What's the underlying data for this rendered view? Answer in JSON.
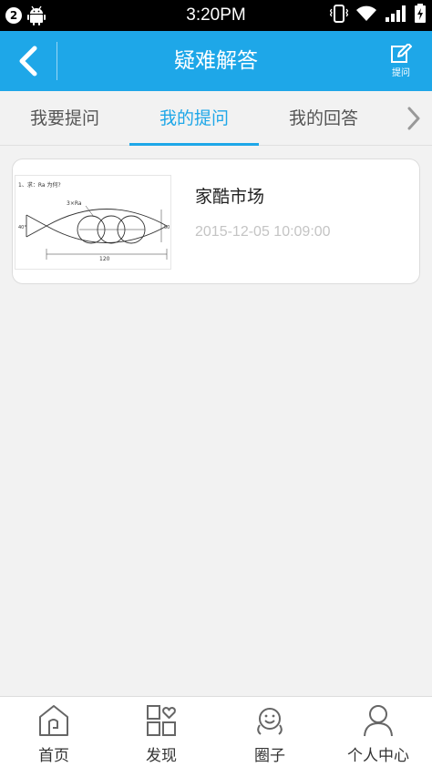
{
  "status_bar": {
    "notification_count": "2",
    "time": "3:20PM",
    "icons": [
      "android-icon",
      "vibrate-icon",
      "wifi-icon",
      "signal-icon",
      "battery-charging-icon"
    ]
  },
  "header": {
    "title": "疑难解答",
    "back_icon": "back-arrow-icon",
    "ask_label": "提问",
    "ask_icon": "edit-icon"
  },
  "tabs": [
    {
      "label": "我要提问",
      "active": false
    },
    {
      "label": "我的提问",
      "active": true
    },
    {
      "label": "我的回答",
      "active": false
    }
  ],
  "questions": [
    {
      "title": "家酷市场",
      "time": "2015-12-05 10:09:00",
      "thumbnail": {
        "question": "1、求：Ra 为何?",
        "label_circles": "3×Ra",
        "label_width": "120",
        "label_height": "50",
        "label_angle": "40°"
      }
    }
  ],
  "bottom_nav": [
    {
      "label": "首页",
      "icon": "home-icon"
    },
    {
      "label": "发现",
      "icon": "discover-icon"
    },
    {
      "label": "圈子",
      "icon": "circle-icon"
    },
    {
      "label": "个人中心",
      "icon": "user-icon"
    }
  ],
  "colors": {
    "accent": "#1ea7e8",
    "background": "#f2f2f2",
    "status_bar": "#000000"
  }
}
